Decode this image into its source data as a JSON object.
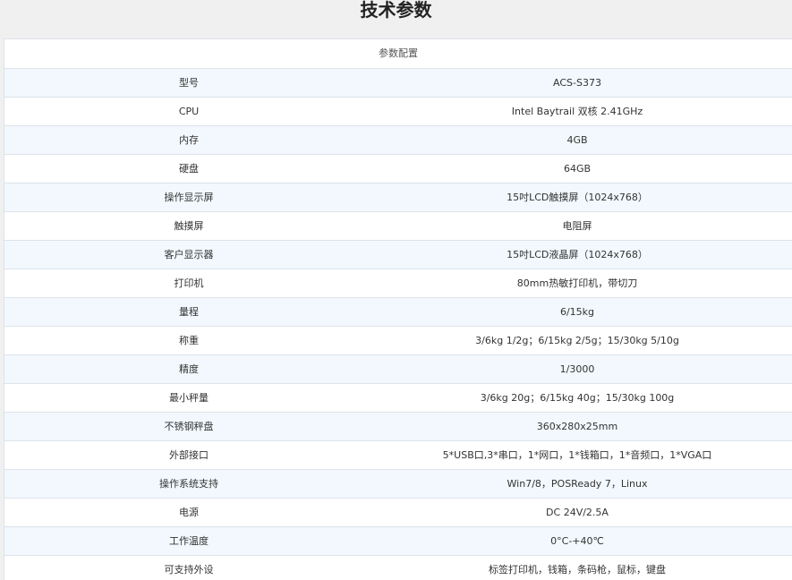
{
  "page_title": "技术参数",
  "table": {
    "header": "参数配置",
    "rows": [
      {
        "label": "型号",
        "value": "ACS-S373"
      },
      {
        "label": "CPU",
        "value": "Intel Baytrail 双核 2.41GHz"
      },
      {
        "label": "内存",
        "value": "4GB"
      },
      {
        "label": "硬盘",
        "value": "64GB"
      },
      {
        "label": "操作显示屏",
        "value": "15吋LCD触摸屏（1024x768）"
      },
      {
        "label": "触摸屏",
        "value": "电阻屏"
      },
      {
        "label": "客户显示器",
        "value": "15吋LCD液晶屏（1024x768）"
      },
      {
        "label": "打印机",
        "value": "80mm热敏打印机，带切刀"
      },
      {
        "label": "量程",
        "value": "6/15kg"
      },
      {
        "label": "称重",
        "value": "3/6kg 1/2g；6/15kg 2/5g；15/30kg 5/10g"
      },
      {
        "label": "精度",
        "value": "1/3000"
      },
      {
        "label": "最小秤量",
        "value": "3/6kg 20g；6/15kg 40g；15/30kg 100g"
      },
      {
        "label": "不锈钢秤盘",
        "value": "360x280x25mm"
      },
      {
        "label": "外部接口",
        "value": "5*USB口,3*串口，1*网口，1*钱箱口，1*音频口，1*VGA口"
      },
      {
        "label": "操作系统支持",
        "value": "Win7/8，POSReady 7，Linux"
      },
      {
        "label": "电源",
        "value": "DC 24V/2.5A"
      },
      {
        "label": "工作温度",
        "value": "0°C-+40℃"
      },
      {
        "label": "可支持外设",
        "value": "标签打印机，钱箱，条码枪，鼠标，键盘"
      }
    ]
  }
}
